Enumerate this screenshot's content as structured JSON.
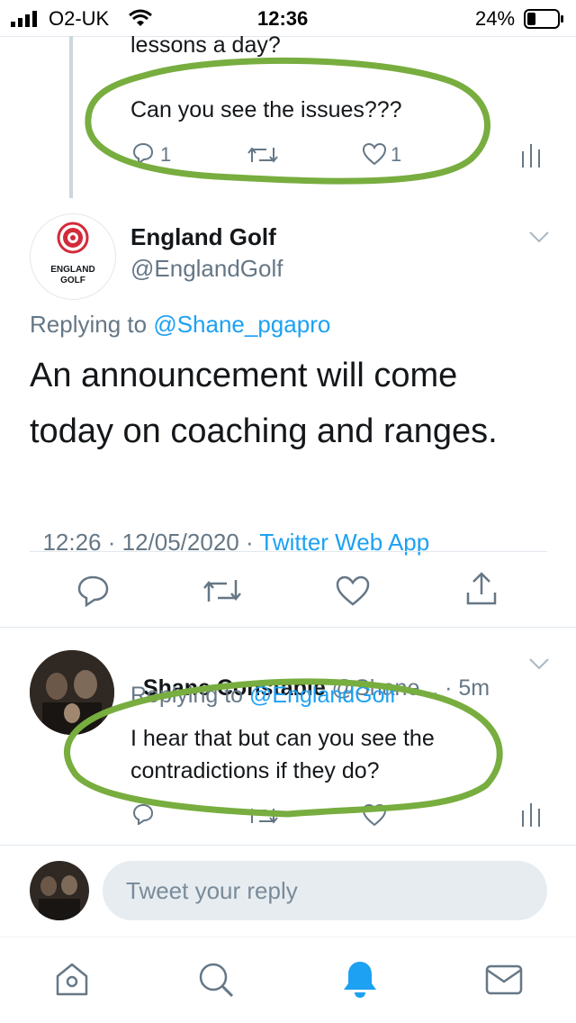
{
  "status": {
    "carrier": "O2-UK",
    "time": "12:36",
    "battery": "24%"
  },
  "prev_tweet": {
    "text_line1": "lessons a day?",
    "text_line2": "Can you see the issues???",
    "reply_count": "1",
    "like_count": "1"
  },
  "main_tweet": {
    "display_name": "England Golf",
    "handle": "@EnglandGolf",
    "logo_text_line1": "ENGLAND",
    "logo_text_line2": "GOLF",
    "replying_prefix": "Replying to ",
    "replying_handle": "@Shane_pgapro",
    "text_line1": "An announcement will come",
    "text_line2": "today on coaching and ranges.",
    "timestamp": "12:26 · 12/05/2020 · ",
    "source": "Twitter Web App"
  },
  "reply_tweet": {
    "display_name": "Shane Constable",
    "handle_time": " @Shane... · 5m",
    "replying_prefix": "Replying to ",
    "replying_handle": "@EnglandGolf",
    "text_line1": "I hear that but can you see the",
    "text_line2": "contradictions if they do?"
  },
  "composer": {
    "placeholder": "Tweet your reply"
  },
  "colors": {
    "accent": "#1da1f2",
    "annotation": "#78ad3f",
    "muted": "#657786"
  },
  "icons": [
    "reply-icon",
    "retweet-icon",
    "like-icon",
    "share-icon",
    "analytics-icon",
    "chevron-down-icon",
    "home-icon",
    "search-icon",
    "notifications-icon",
    "messages-icon"
  ]
}
